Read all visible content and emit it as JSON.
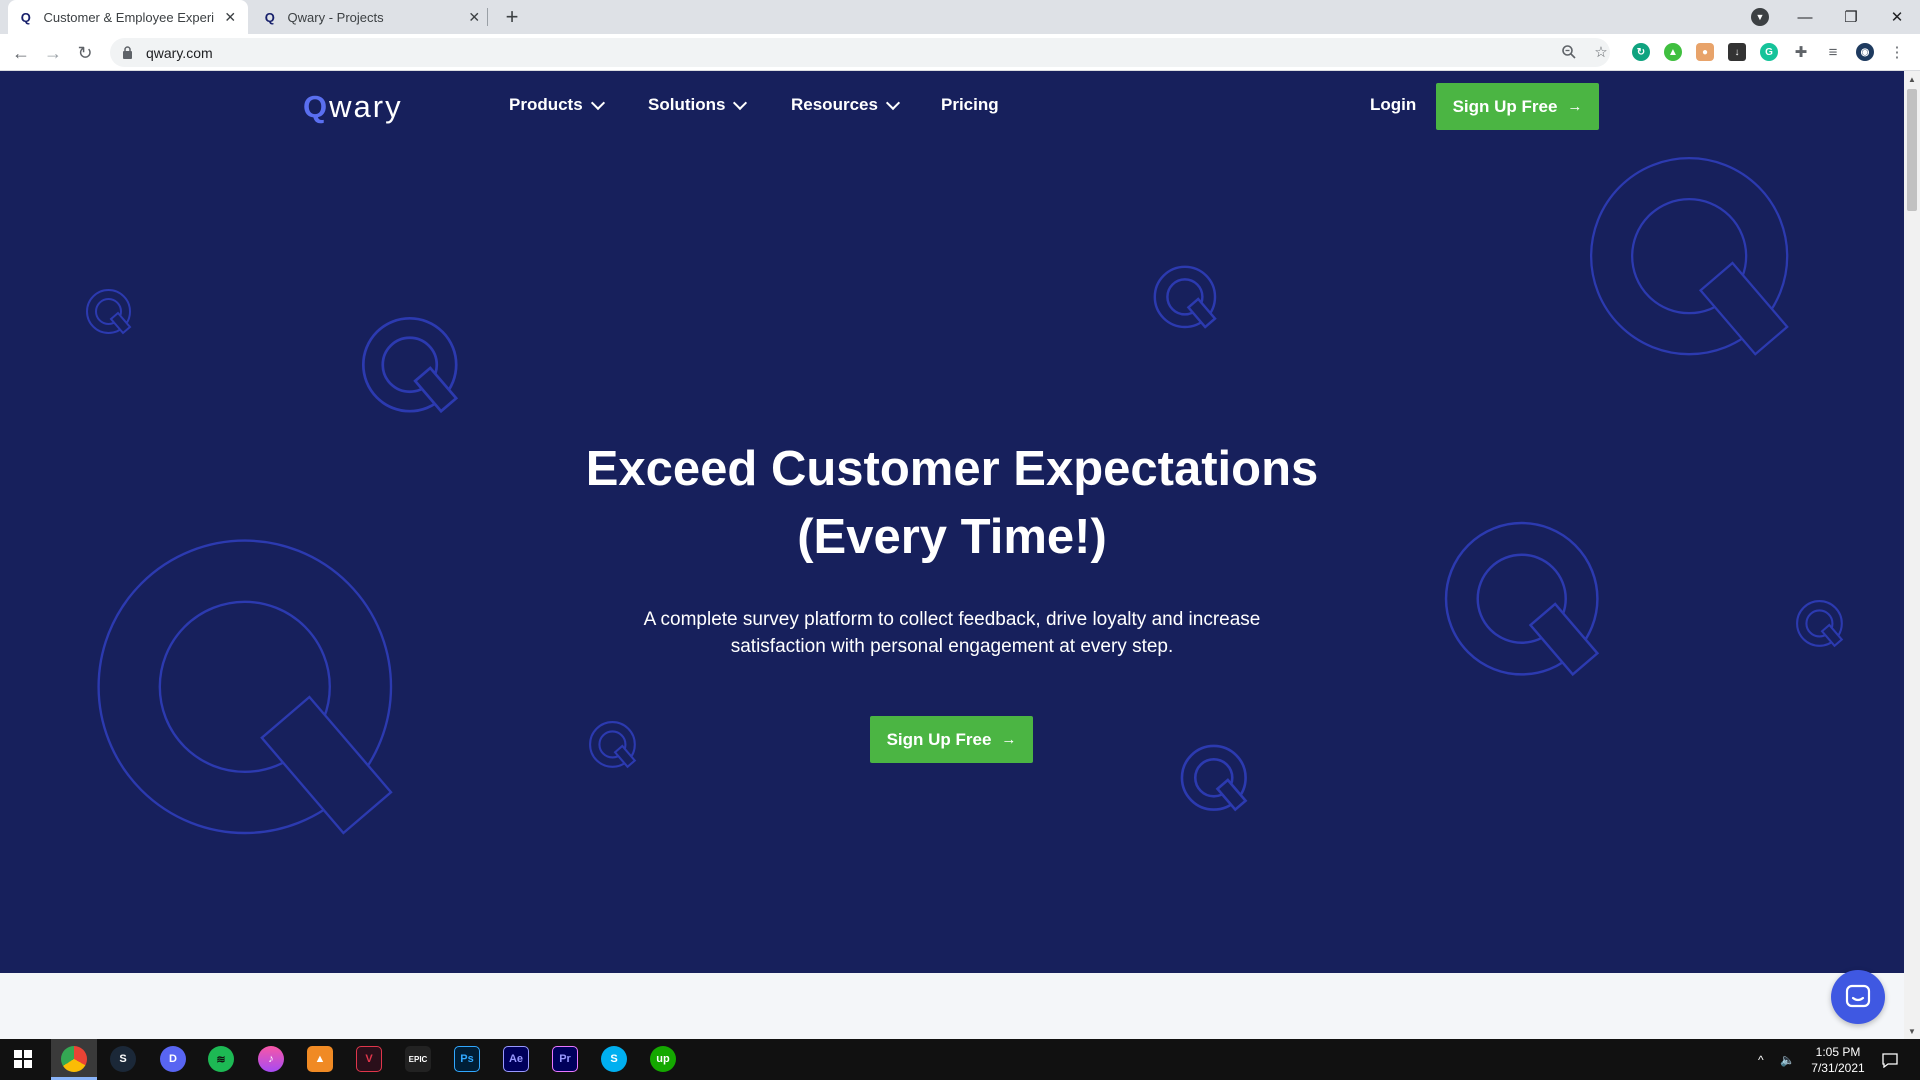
{
  "browser": {
    "tabs": [
      {
        "title": "Customer & Employee Experienc",
        "active": true
      },
      {
        "title": "Qwary - Projects",
        "active": false
      }
    ],
    "url": "qwary.com"
  },
  "site": {
    "logo_q": "Q",
    "logo_rest": "wary",
    "nav": {
      "products": "Products",
      "solutions": "Solutions",
      "resources": "Resources",
      "pricing": "Pricing",
      "login": "Login",
      "signup": "Sign Up Free"
    },
    "hero": {
      "headline_line1": "Exceed Customer Expectations",
      "headline_line2": "(Every Time!)",
      "subtext_line1": "A complete survey platform to collect feedback, drive loyalty and increase",
      "subtext_line2": "satisfaction with personal engagement at every step.",
      "cta": "Sign Up Free"
    }
  },
  "taskbar": {
    "time": "1:05 PM",
    "date": "7/31/2021",
    "apps": [
      "windows-start",
      "chrome",
      "steam",
      "discord",
      "spotify",
      "itunes",
      "vlc",
      "vivaldi",
      "epic-games",
      "photoshop",
      "after-effects",
      "premiere-pro",
      "skype",
      "upwork"
    ]
  },
  "colors": {
    "hero_bg": "#17205c",
    "accent_green": "#4bb543",
    "logo_blue": "#5a6ff0",
    "decor_outline": "#2c3ab0",
    "chat_blue": "#3f58e2"
  }
}
